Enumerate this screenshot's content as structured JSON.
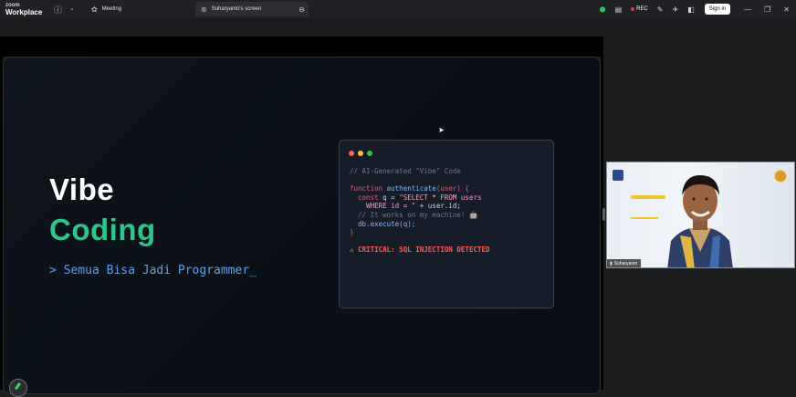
{
  "titlebar": {
    "logo_line1": "zoom",
    "logo_line2": "Workplace",
    "tabs": [
      {
        "label": "Meeting",
        "icon": "meeting-icon"
      },
      {
        "label": "Suharyanto's screen",
        "icon": "screen-share-icon"
      }
    ],
    "rec_label": "REC",
    "signin_label": "Sign in"
  },
  "slide": {
    "title_line1": "Vibe",
    "title_line2": "Coding",
    "tagline": "> Semua Bisa Jadi Programmer_",
    "code_comment": "// AI-Generated \"Vibe\" Code",
    "code_lines": {
      "l1_kw": "function",
      "l1_fn": "authenticate",
      "l1_rest": "(user) {",
      "l2_kw": "const",
      "l2_rest": " q = ",
      "l2_str": "\"SELECT * FROM users",
      "l3_str": "WHERE id = \"",
      "l3_rest": " + user.id;",
      "l4_com": "// It works on my machine!",
      "l5_rest": "db.execute(q);",
      "l6_rest": "}"
    },
    "warning": "CRITICAL: SQL INJECTION DETECTED"
  },
  "video": {
    "participant_name": "Suharyanto"
  },
  "colors": {
    "accent_green": "#2fc58a",
    "tagline_blue": "#5aa0ee",
    "warning_red": "#ff5a5a",
    "dot_red": "#ff5f57",
    "dot_yellow": "#febc2e",
    "dot_green": "#28c840"
  }
}
